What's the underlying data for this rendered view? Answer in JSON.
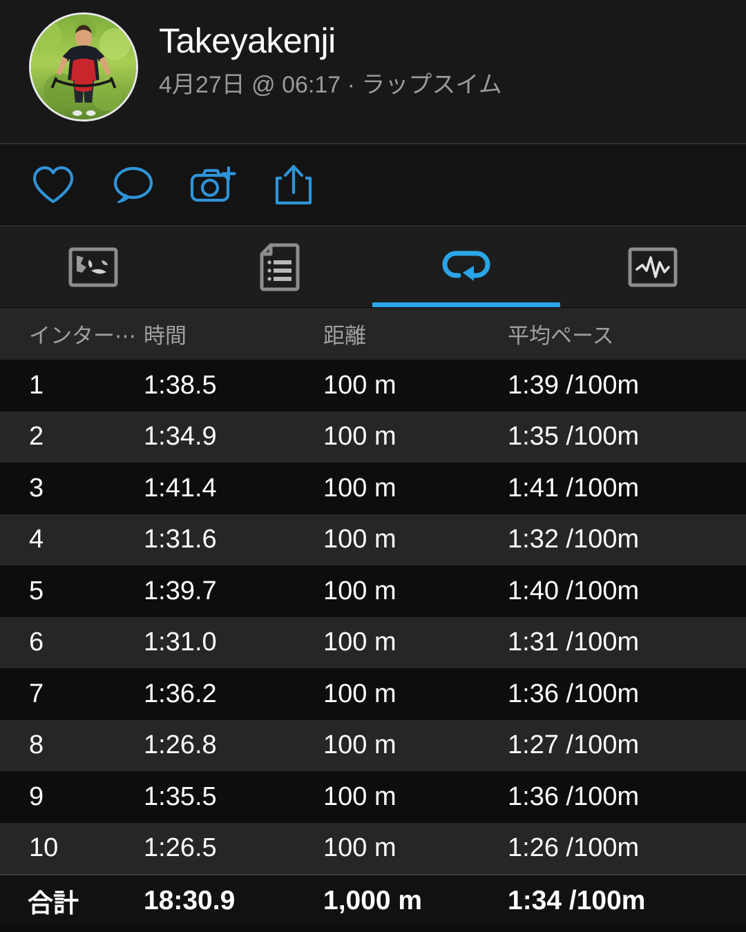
{
  "header": {
    "profile_name": "Takeyakenji",
    "activity_meta": "4月27日 @ 06:17 · ラップスイム",
    "avatar_alt": "cyclist-profile-photo"
  },
  "action_bar": {
    "items": [
      {
        "name": "like-button",
        "icon": "heart-icon",
        "label": "いいね"
      },
      {
        "name": "comment-button",
        "icon": "comment-icon",
        "label": "コメント"
      },
      {
        "name": "photo-button",
        "icon": "camera-add-icon",
        "label": "写真を追加"
      },
      {
        "name": "share-button",
        "icon": "share-icon",
        "label": "共有"
      }
    ]
  },
  "tabs": {
    "active_index": 2,
    "items": [
      {
        "name": "tab-map",
        "icon": "map-icon",
        "label": "マップ"
      },
      {
        "name": "tab-details",
        "icon": "document-icon",
        "label": "詳細"
      },
      {
        "name": "tab-laps",
        "icon": "lap-icon",
        "label": "ラップ"
      },
      {
        "name": "tab-analysis",
        "icon": "analysis-icon",
        "label": "分析"
      }
    ],
    "accent_color": "#2aa5e8"
  },
  "table": {
    "columns": [
      "インター⋯",
      "時間",
      "距離",
      "平均ペース"
    ],
    "rows": [
      {
        "interval": "1",
        "time": "1:38.5",
        "distance": "100 m",
        "pace": "1:39 /100m"
      },
      {
        "interval": "2",
        "time": "1:34.9",
        "distance": "100 m",
        "pace": "1:35 /100m"
      },
      {
        "interval": "3",
        "time": "1:41.4",
        "distance": "100 m",
        "pace": "1:41 /100m"
      },
      {
        "interval": "4",
        "time": "1:31.6",
        "distance": "100 m",
        "pace": "1:32 /100m"
      },
      {
        "interval": "5",
        "time": "1:39.7",
        "distance": "100 m",
        "pace": "1:40 /100m"
      },
      {
        "interval": "6",
        "time": "1:31.0",
        "distance": "100 m",
        "pace": "1:31 /100m"
      },
      {
        "interval": "7",
        "time": "1:36.2",
        "distance": "100 m",
        "pace": "1:36 /100m"
      },
      {
        "interval": "8",
        "time": "1:26.8",
        "distance": "100 m",
        "pace": "1:27 /100m"
      },
      {
        "interval": "9",
        "time": "1:35.5",
        "distance": "100 m",
        "pace": "1:36 /100m"
      },
      {
        "interval": "10",
        "time": "1:26.5",
        "distance": "100 m",
        "pace": "1:26 /100m"
      }
    ],
    "total": {
      "interval": "合計",
      "time": "18:30.9",
      "distance": "1,000 m",
      "pace": "1:34 /100m"
    }
  }
}
